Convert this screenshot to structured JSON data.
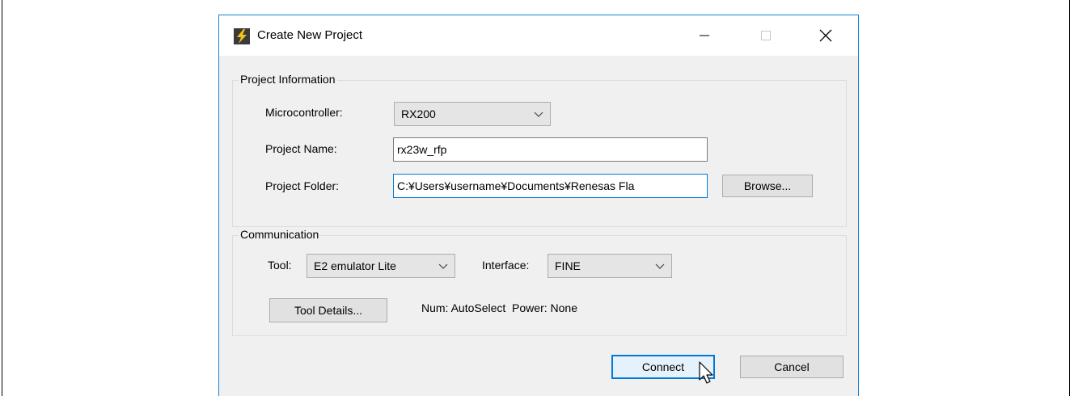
{
  "window": {
    "title": "Create New Project",
    "accent": "#0078d7"
  },
  "project_information": {
    "group_label": "Project Information",
    "microcontroller_label": "Microcontroller:",
    "microcontroller_value": "RX200",
    "project_name_label": "Project Name:",
    "project_name_value": "rx23w_rfp",
    "project_folder_label": "Project Folder:",
    "project_folder_value": "C:¥Users¥username¥Documents¥Renesas Fla",
    "browse_label": "Browse..."
  },
  "communication": {
    "group_label": "Communication",
    "tool_label": "Tool:",
    "tool_value": "E2 emulator Lite",
    "interface_label": "Interface:",
    "interface_value": "FINE",
    "tool_details_label": "Tool Details...",
    "status_text": "Num: AutoSelect  Power: None"
  },
  "footer": {
    "connect_label": "Connect",
    "cancel_label": "Cancel"
  }
}
